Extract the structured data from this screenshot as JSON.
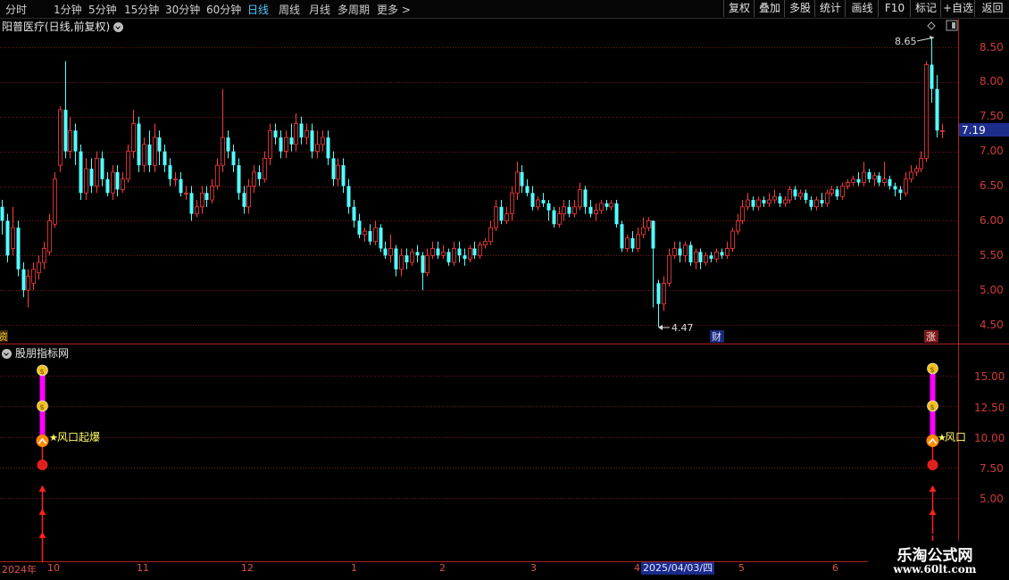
{
  "toolbar": {
    "periods": [
      "分时",
      "1分钟",
      "5分钟",
      "15分钟",
      "30分钟",
      "60分钟",
      "日线",
      "周线",
      "月线",
      "多周期",
      "更多 >"
    ],
    "active_period": "日线",
    "right": [
      "复权",
      "叠加",
      "多股",
      "统计",
      "画线",
      "F10",
      "+自选",
      "返回"
    ]
  },
  "main_chart": {
    "title": "阳普医疗(日线,前复权)",
    "y_ticks": [
      "8.50",
      "8.00",
      "7.50",
      "7.00",
      "6.50",
      "6.00",
      "5.50",
      "5.00",
      "4.50"
    ],
    "last_price": "7.19",
    "high_label": "8.65",
    "low_label": "4.47",
    "marker_cai": "财",
    "marker_zhang": "涨",
    "marker_left": "资"
  },
  "indicator": {
    "title": "股朋指标网",
    "y_ticks": [
      "15.00",
      "12.50",
      "10.00",
      "7.50",
      "5.00"
    ],
    "signal_label": "风口起爆",
    "signal_label_right": "风口"
  },
  "time_axis": {
    "year": "2024年",
    "months": [
      "10",
      "11",
      "12",
      "1",
      "2",
      "3",
      "4",
      "5",
      "6"
    ],
    "cursor_date": "2025/04/03/四"
  },
  "watermark": {
    "title": "乐淘公式网",
    "url": "www.60lt.com"
  },
  "colors": {
    "up": "#ff3b3b",
    "down": "#54ffff",
    "grid": "#7a1a1a",
    "axis": "#b02020",
    "signal": "#ff00ff",
    "label_yellow": "#ffff66"
  },
  "chart_data": {
    "type": "candlestick",
    "ylim": [
      4.3,
      8.85
    ],
    "candles": [
      [
        6.2,
        6.0,
        6.3,
        5.8
      ],
      [
        6.0,
        5.5,
        6.1,
        5.4
      ],
      [
        5.6,
        5.9,
        6.2,
        5.5
      ],
      [
        5.9,
        5.3,
        6.0,
        5.2
      ],
      [
        5.3,
        5.0,
        5.4,
        4.9
      ],
      [
        5.0,
        5.2,
        5.3,
        4.75
      ],
      [
        5.1,
        5.3,
        5.4,
        5.0
      ],
      [
        5.25,
        5.4,
        5.5,
        5.15
      ],
      [
        5.4,
        5.6,
        5.7,
        5.3
      ],
      [
        5.55,
        6.0,
        6.1,
        5.5
      ],
      [
        5.95,
        6.6,
        6.7,
        5.9
      ],
      [
        6.8,
        7.6,
        7.65,
        6.7
      ],
      [
        7.6,
        7.0,
        8.3,
        6.9
      ],
      [
        7.0,
        7.3,
        7.5,
        6.9
      ],
      [
        7.3,
        7.0,
        7.4,
        6.8
      ],
      [
        7.0,
        6.4,
        7.1,
        6.3
      ],
      [
        6.4,
        6.75,
        6.9,
        6.3
      ],
      [
        6.75,
        6.5,
        6.9,
        6.4
      ],
      [
        6.5,
        6.9,
        7.0,
        6.4
      ],
      [
        6.9,
        6.6,
        7.0,
        6.5
      ],
      [
        6.6,
        6.4,
        6.7,
        6.35
      ],
      [
        6.4,
        6.7,
        6.8,
        6.3
      ],
      [
        6.7,
        6.45,
        6.8,
        6.35
      ],
      [
        6.45,
        6.6,
        6.7,
        6.4
      ],
      [
        6.6,
        7.0,
        7.1,
        6.55
      ],
      [
        7.0,
        7.4,
        7.6,
        6.9
      ],
      [
        7.4,
        6.8,
        7.5,
        6.7
      ],
      [
        6.8,
        7.1,
        7.2,
        6.7
      ],
      [
        7.1,
        6.8,
        7.3,
        6.7
      ],
      [
        6.8,
        7.2,
        7.4,
        6.7
      ],
      [
        7.2,
        7.0,
        7.3,
        6.8
      ],
      [
        7.0,
        6.8,
        7.1,
        6.7
      ],
      [
        6.8,
        6.6,
        6.9,
        6.5
      ],
      [
        6.6,
        6.6,
        6.7,
        6.5
      ],
      [
        6.6,
        6.4,
        6.7,
        6.35
      ],
      [
        6.4,
        6.4,
        6.5,
        6.3
      ],
      [
        6.4,
        6.1,
        6.5,
        6.0
      ],
      [
        6.1,
        6.2,
        6.3,
        6.05
      ],
      [
        6.2,
        6.4,
        6.5,
        6.1
      ],
      [
        6.4,
        6.3,
        6.5,
        6.2
      ],
      [
        6.3,
        6.5,
        6.6,
        6.25
      ],
      [
        6.5,
        6.8,
        6.9,
        6.45
      ],
      [
        6.8,
        7.2,
        7.9,
        6.7
      ],
      [
        7.2,
        7.0,
        7.3,
        6.9
      ],
      [
        7.0,
        6.8,
        7.1,
        6.7
      ],
      [
        6.8,
        6.4,
        6.9,
        6.3
      ],
      [
        6.4,
        6.2,
        6.5,
        6.1
      ],
      [
        6.2,
        6.5,
        6.6,
        6.1
      ],
      [
        6.5,
        6.7,
        6.8,
        6.4
      ],
      [
        6.7,
        6.6,
        6.8,
        6.5
      ],
      [
        6.6,
        6.9,
        7.0,
        6.55
      ],
      [
        6.9,
        7.3,
        7.4,
        6.8
      ],
      [
        7.3,
        7.2,
        7.4,
        7.1
      ],
      [
        7.2,
        7.0,
        7.3,
        6.9
      ],
      [
        7.0,
        7.2,
        7.3,
        6.9
      ],
      [
        7.2,
        7.1,
        7.4,
        7.0
      ],
      [
        7.1,
        7.4,
        7.55,
        7.0
      ],
      [
        7.4,
        7.2,
        7.5,
        7.1
      ],
      [
        7.2,
        7.3,
        7.4,
        7.1
      ],
      [
        7.3,
        7.0,
        7.4,
        6.9
      ],
      [
        7.0,
        7.1,
        7.3,
        6.9
      ],
      [
        7.1,
        7.2,
        7.3,
        7.0
      ],
      [
        7.2,
        6.9,
        7.3,
        6.8
      ],
      [
        6.9,
        6.6,
        7.0,
        6.5
      ],
      [
        6.6,
        6.8,
        6.9,
        6.5
      ],
      [
        6.8,
        6.5,
        6.9,
        6.4
      ],
      [
        6.5,
        6.2,
        6.6,
        6.1
      ],
      [
        6.2,
        6.0,
        6.3,
        5.9
      ],
      [
        6.0,
        5.8,
        6.1,
        5.75
      ],
      [
        5.8,
        5.85,
        5.9,
        5.7
      ],
      [
        5.85,
        5.7,
        5.95,
        5.65
      ],
      [
        5.7,
        5.9,
        6.0,
        5.65
      ],
      [
        5.9,
        5.6,
        5.95,
        5.55
      ],
      [
        5.6,
        5.5,
        5.7,
        5.45
      ],
      [
        5.5,
        5.6,
        5.8,
        5.4
      ],
      [
        5.6,
        5.3,
        5.65,
        5.2
      ],
      [
        5.3,
        5.5,
        5.6,
        5.2
      ],
      [
        5.5,
        5.4,
        5.6,
        5.3
      ],
      [
        5.4,
        5.55,
        5.6,
        5.35
      ],
      [
        5.55,
        5.5,
        5.65,
        5.4
      ],
      [
        5.5,
        5.25,
        5.55,
        5.0
      ],
      [
        5.25,
        5.5,
        5.6,
        5.2
      ],
      [
        5.5,
        5.6,
        5.7,
        5.45
      ],
      [
        5.6,
        5.5,
        5.7,
        5.45
      ],
      [
        5.5,
        5.55,
        5.65,
        5.45
      ],
      [
        5.55,
        5.4,
        5.6,
        5.35
      ],
      [
        5.4,
        5.6,
        5.7,
        5.35
      ],
      [
        5.6,
        5.5,
        5.7,
        5.4
      ],
      [
        5.5,
        5.45,
        5.6,
        5.35
      ],
      [
        5.45,
        5.6,
        5.65,
        5.4
      ],
      [
        5.6,
        5.5,
        5.7,
        5.45
      ],
      [
        5.5,
        5.65,
        5.7,
        5.45
      ],
      [
        5.65,
        5.7,
        5.75,
        5.6
      ],
      [
        5.7,
        5.9,
        6.0,
        5.65
      ],
      [
        5.9,
        6.2,
        6.3,
        5.85
      ],
      [
        6.2,
        6.0,
        6.3,
        5.95
      ],
      [
        6.0,
        6.1,
        6.2,
        5.95
      ],
      [
        6.1,
        6.4,
        6.5,
        6.0
      ],
      [
        6.4,
        6.7,
        6.85,
        6.3
      ],
      [
        6.7,
        6.5,
        6.8,
        6.4
      ],
      [
        6.5,
        6.4,
        6.6,
        6.35
      ],
      [
        6.4,
        6.2,
        6.5,
        6.15
      ],
      [
        6.2,
        6.3,
        6.35,
        6.15
      ],
      [
        6.3,
        6.25,
        6.4,
        6.2
      ],
      [
        6.25,
        6.15,
        6.3,
        6.0
      ],
      [
        6.15,
        5.95,
        6.2,
        5.9
      ],
      [
        5.95,
        6.1,
        6.2,
        5.9
      ],
      [
        6.1,
        6.2,
        6.3,
        6.0
      ],
      [
        6.2,
        6.1,
        6.3,
        6.05
      ],
      [
        6.1,
        6.2,
        6.3,
        6.05
      ],
      [
        6.2,
        6.45,
        6.55,
        6.15
      ],
      [
        6.45,
        6.2,
        6.5,
        6.1
      ],
      [
        6.2,
        6.1,
        6.3,
        6.05
      ],
      [
        6.1,
        6.15,
        6.25,
        6.0
      ],
      [
        6.15,
        6.25,
        6.3,
        6.1
      ],
      [
        6.25,
        6.2,
        6.3,
        6.15
      ],
      [
        6.2,
        6.25,
        6.3,
        6.15
      ],
      [
        6.25,
        5.95,
        6.3,
        5.9
      ],
      [
        5.95,
        5.6,
        6.0,
        5.55
      ],
      [
        5.6,
        5.75,
        5.8,
        5.55
      ],
      [
        5.75,
        5.6,
        5.85,
        5.55
      ],
      [
        5.6,
        5.8,
        5.9,
        5.55
      ],
      [
        5.8,
        5.9,
        6.05,
        5.75
      ],
      [
        5.9,
        6.0,
        6.05,
        5.85
      ],
      [
        6.0,
        5.6,
        6.0,
        4.75
      ],
      [
        5.1,
        4.8,
        5.15,
        4.47
      ],
      [
        4.8,
        5.1,
        5.2,
        4.7
      ],
      [
        5.1,
        5.5,
        5.6,
        5.05
      ],
      [
        5.5,
        5.6,
        5.7,
        5.45
      ],
      [
        5.6,
        5.5,
        5.7,
        5.4
      ],
      [
        5.5,
        5.65,
        5.7,
        5.4
      ],
      [
        5.65,
        5.4,
        5.7,
        5.35
      ],
      [
        5.4,
        5.55,
        5.6,
        5.3
      ],
      [
        5.55,
        5.4,
        5.6,
        5.3
      ],
      [
        5.4,
        5.5,
        5.55,
        5.35
      ],
      [
        5.5,
        5.45,
        5.55,
        5.4
      ],
      [
        5.45,
        5.55,
        5.6,
        5.4
      ],
      [
        5.55,
        5.5,
        5.6,
        5.45
      ],
      [
        5.5,
        5.6,
        5.7,
        5.45
      ],
      [
        5.6,
        5.85,
        5.9,
        5.55
      ],
      [
        5.85,
        6.0,
        6.1,
        5.8
      ],
      [
        6.0,
        6.2,
        6.3,
        5.95
      ],
      [
        6.2,
        6.3,
        6.4,
        6.15
      ],
      [
        6.3,
        6.2,
        6.35,
        6.15
      ],
      [
        6.2,
        6.3,
        6.35,
        6.15
      ],
      [
        6.3,
        6.25,
        6.35,
        6.2
      ],
      [
        6.25,
        6.3,
        6.4,
        6.2
      ],
      [
        6.3,
        6.35,
        6.45,
        6.25
      ],
      [
        6.35,
        6.25,
        6.4,
        6.2
      ],
      [
        6.25,
        6.3,
        6.35,
        6.2
      ],
      [
        6.3,
        6.45,
        6.5,
        6.25
      ],
      [
        6.45,
        6.35,
        6.5,
        6.3
      ],
      [
        6.35,
        6.4,
        6.45,
        6.3
      ],
      [
        6.4,
        6.3,
        6.45,
        6.25
      ],
      [
        6.3,
        6.2,
        6.35,
        6.15
      ],
      [
        6.2,
        6.3,
        6.35,
        6.15
      ],
      [
        6.3,
        6.25,
        6.4,
        6.2
      ],
      [
        6.25,
        6.4,
        6.45,
        6.2
      ],
      [
        6.4,
        6.45,
        6.5,
        6.35
      ],
      [
        6.45,
        6.35,
        6.5,
        6.3
      ],
      [
        6.35,
        6.5,
        6.55,
        6.3
      ],
      [
        6.5,
        6.55,
        6.6,
        6.45
      ],
      [
        6.55,
        6.6,
        6.65,
        6.5
      ],
      [
        6.6,
        6.55,
        6.7,
        6.5
      ],
      [
        6.55,
        6.7,
        6.85,
        6.5
      ],
      [
        6.7,
        6.6,
        6.75,
        6.55
      ],
      [
        6.6,
        6.65,
        6.7,
        6.5
      ],
      [
        6.65,
        6.55,
        6.7,
        6.5
      ],
      [
        6.55,
        6.6,
        6.85,
        6.5
      ],
      [
        6.6,
        6.5,
        6.65,
        6.45
      ],
      [
        6.5,
        6.45,
        6.55,
        6.35
      ],
      [
        6.45,
        6.4,
        6.5,
        6.3
      ],
      [
        6.4,
        6.6,
        6.7,
        6.35
      ],
      [
        6.6,
        6.7,
        6.8,
        6.55
      ],
      [
        6.7,
        6.75,
        6.8,
        6.65
      ],
      [
        6.75,
        6.9,
        7.0,
        6.7
      ],
      [
        6.9,
        8.25,
        8.3,
        6.85
      ],
      [
        8.25,
        7.9,
        8.65,
        7.7
      ],
      [
        7.9,
        7.3,
        8.1,
        7.2
      ],
      [
        7.3,
        7.3,
        7.4,
        7.19
      ]
    ]
  }
}
